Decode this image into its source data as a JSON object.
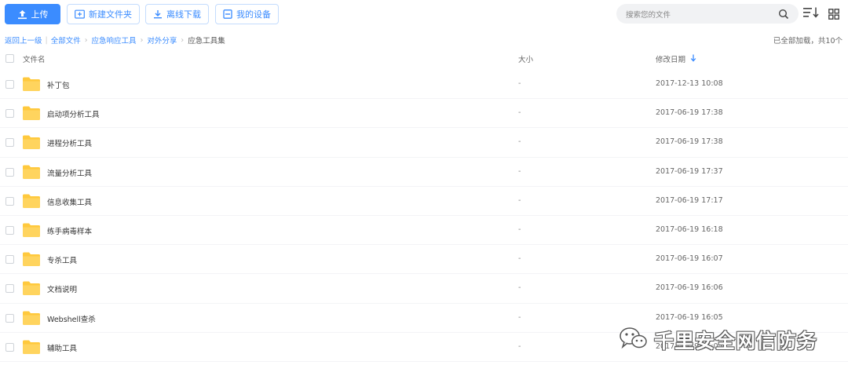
{
  "toolbar": {
    "upload_label": "上传",
    "new_folder_label": "新建文件夹",
    "offline_download_label": "离线下载",
    "my_devices_label": "我的设备",
    "search_placeholder": "搜索您的文件"
  },
  "breadcrumb": {
    "back": "返回上一级",
    "items": [
      "全部文件",
      "应急响应工具",
      "对外分享"
    ],
    "current": "应急工具集"
  },
  "status": {
    "loaded_text": "已全部加载，共10个"
  },
  "table": {
    "headers": {
      "name": "文件名",
      "size": "大小",
      "modified": "修改日期"
    },
    "rows": [
      {
        "name": "补丁包",
        "size": "-",
        "modified": "2017-12-13 10:08"
      },
      {
        "name": "启动项分析工具",
        "size": "-",
        "modified": "2017-06-19 17:38"
      },
      {
        "name": "进程分析工具",
        "size": "-",
        "modified": "2017-06-19 17:38"
      },
      {
        "name": "流量分析工具",
        "size": "-",
        "modified": "2017-06-19 17:37"
      },
      {
        "name": "信息收集工具",
        "size": "-",
        "modified": "2017-06-19 17:17"
      },
      {
        "name": "练手病毒样本",
        "size": "-",
        "modified": "2017-06-19 16:18"
      },
      {
        "name": "专杀工具",
        "size": "-",
        "modified": "2017-06-19 16:07"
      },
      {
        "name": "文档说明",
        "size": "-",
        "modified": "2017-06-19 16:06"
      },
      {
        "name": "Webshell查杀",
        "size": "-",
        "modified": "2017-06-19 16:05"
      },
      {
        "name": "辅助工具",
        "size": "-",
        "modified": "2017-06-19 16:05"
      }
    ]
  },
  "watermark": {
    "text": "千里安全网信防务"
  },
  "colors": {
    "accent": "#3b8cff",
    "folder": "#ffc93d"
  },
  "icons": [
    "upload-icon",
    "new-folder-icon",
    "download-icon",
    "device-icon",
    "search-icon",
    "sort-icon",
    "grid-view-icon",
    "folder-icon",
    "sort-desc-arrow-icon",
    "wechat-icon"
  ]
}
